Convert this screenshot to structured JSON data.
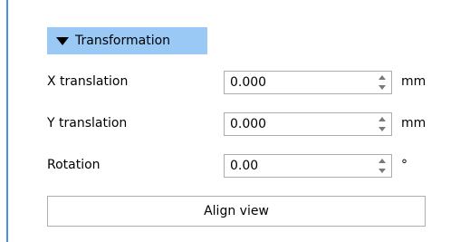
{
  "section": {
    "title": "Transformation",
    "expanded": true
  },
  "fields": [
    {
      "label": "X translation",
      "value": "0.000",
      "unit": "mm"
    },
    {
      "label": "Y translation",
      "value": "0.000",
      "unit": "mm"
    },
    {
      "label": "Rotation",
      "value": "0.00",
      "unit": "°"
    }
  ],
  "buttons": {
    "align_view": "Align view"
  },
  "colors": {
    "header_bg": "#99c9f4",
    "left_border": "#4a90d9",
    "input_border": "#adadad"
  }
}
